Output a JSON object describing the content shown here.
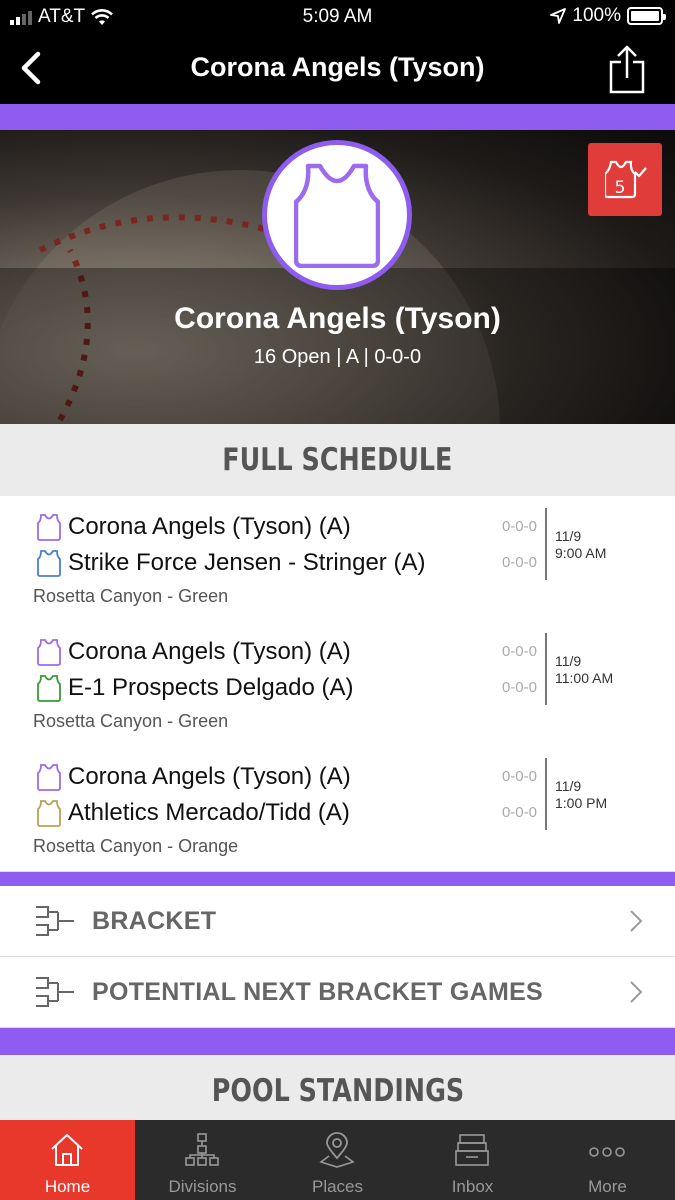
{
  "status_bar": {
    "carrier": "AT&T",
    "time": "5:09 AM",
    "battery": "100%"
  },
  "nav": {
    "title": "Corona Angels (Tyson)"
  },
  "hero": {
    "team_name": "Corona Angels (Tyson)",
    "meta": "16 Open | A | 0-0-0",
    "badge_number": "5"
  },
  "schedule": {
    "header": "FULL SCHEDULE",
    "games": [
      {
        "home": "Corona Angels (Tyson) (A)",
        "home_score": "0-0-0",
        "home_color": "#9b6cf0",
        "away": "Strike Force Jensen - Stringer (A)",
        "away_score": "0-0-0",
        "away_color": "#4a7fd4",
        "date": "11/9",
        "time": "9:00 AM",
        "venue": "Rosetta Canyon - Green"
      },
      {
        "home": "Corona Angels (Tyson) (A)",
        "home_score": "0-0-0",
        "home_color": "#9b6cf0",
        "away": "E-1 Prospects Delgado (A)",
        "away_score": "0-0-0",
        "away_color": "#3a9a3a",
        "date": "11/9",
        "time": "11:00 AM",
        "venue": "Rosetta Canyon - Green"
      },
      {
        "home": "Corona Angels (Tyson) (A)",
        "home_score": "0-0-0",
        "home_color": "#9b6cf0",
        "away": "Athletics Mercado/Tidd (A)",
        "away_score": "0-0-0",
        "away_color": "#b8a258",
        "date": "11/9",
        "time": "1:00 PM",
        "venue": "Rosetta Canyon - Orange"
      }
    ]
  },
  "links": {
    "bracket": "BRACKET",
    "potential": "POTENTIAL NEXT BRACKET GAMES"
  },
  "standings": {
    "header": "POOL STANDINGS"
  },
  "tabs": [
    {
      "label": "Home",
      "icon": "home-icon"
    },
    {
      "label": "Divisions",
      "icon": "divisions-icon"
    },
    {
      "label": "Places",
      "icon": "map-pin-icon"
    },
    {
      "label": "Inbox",
      "icon": "inbox-icon"
    },
    {
      "label": "More",
      "icon": "more-icon"
    }
  ],
  "colors": {
    "accent_purple": "#8e5cf0",
    "active_tab": "#e8372b",
    "badge_red": "#e03c3a"
  }
}
